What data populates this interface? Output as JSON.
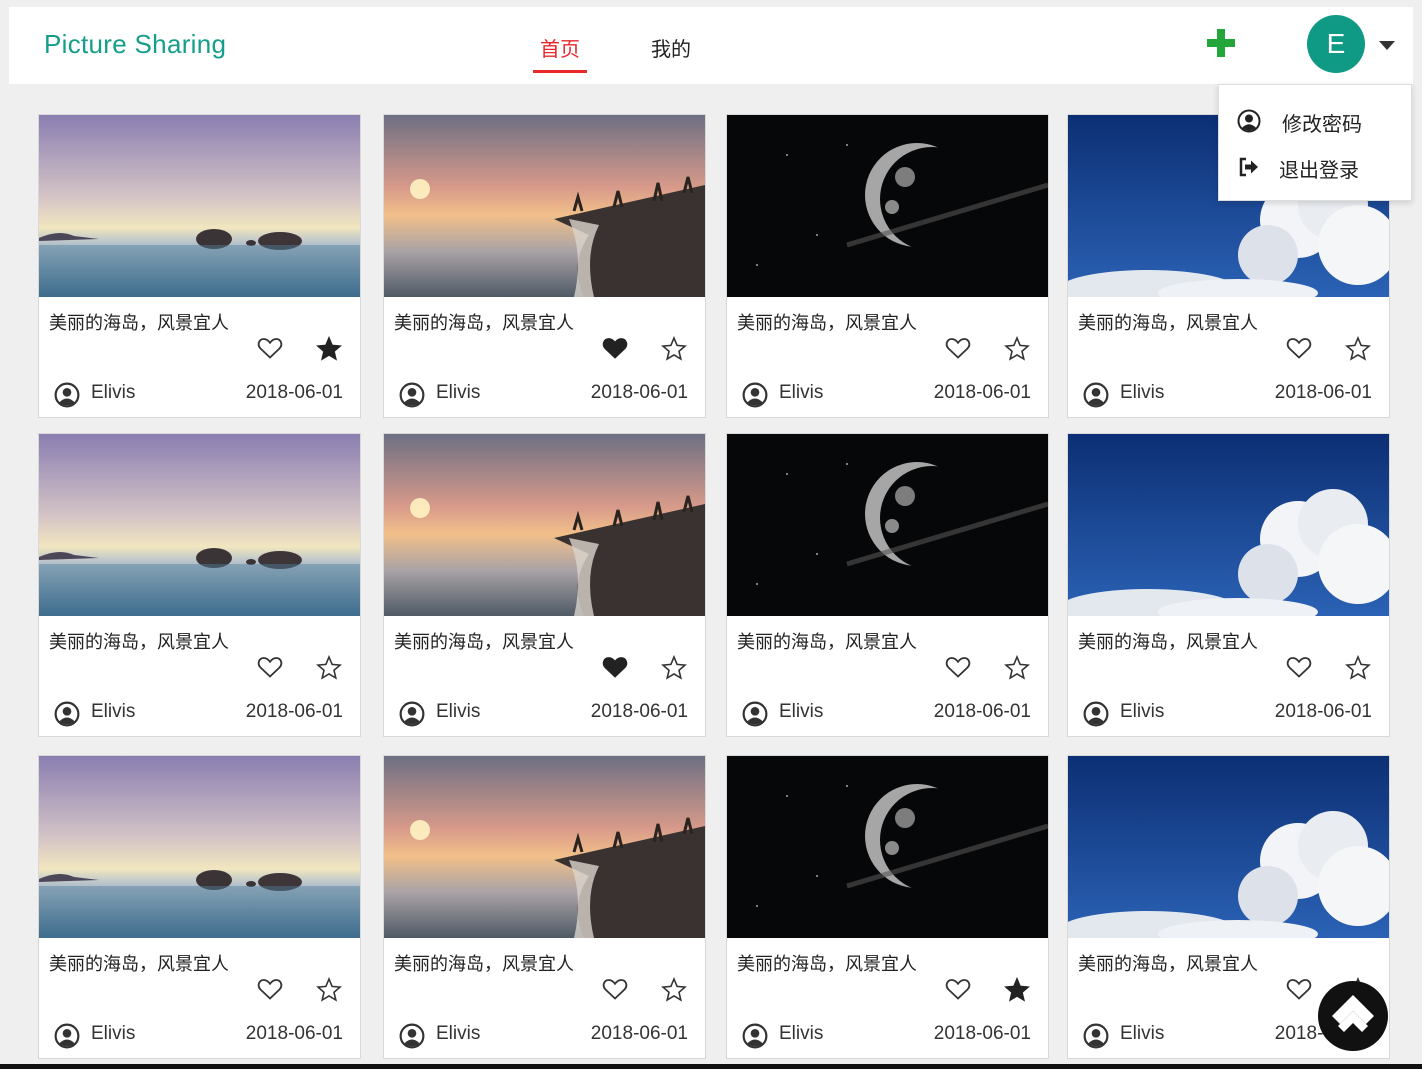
{
  "header": {
    "brand": "Picture Sharing",
    "tabs": [
      {
        "label": "首页",
        "active": true
      },
      {
        "label": "我的",
        "active": false
      }
    ],
    "add_icon": "plus-icon",
    "avatar_letter": "E",
    "caret_icon": "caret-down-icon"
  },
  "dropdown": {
    "items": [
      {
        "label": "修改密码",
        "icon": "user-circle-icon"
      },
      {
        "label": "退出登录",
        "icon": "sign-out-icon"
      }
    ]
  },
  "colors": {
    "brand": "#159f8a",
    "active_tab": "#e8282b",
    "avatar": "#0f9a86",
    "add_icon": "#22a63a"
  },
  "cards": [
    {
      "image": "sea-rocks",
      "title": "美丽的海岛，风景宜人",
      "liked": false,
      "favorited": true,
      "author": "Elivis",
      "date": "2018-06-01"
    },
    {
      "image": "sunset-beach",
      "title": "美丽的海岛，风景宜人",
      "liked": true,
      "favorited": false,
      "author": "Elivis",
      "date": "2018-06-01"
    },
    {
      "image": "moon",
      "title": "美丽的海岛，风景宜人",
      "liked": false,
      "favorited": false,
      "author": "Elivis",
      "date": "2018-06-01"
    },
    {
      "image": "clouds",
      "title": "美丽的海岛，风景宜人",
      "liked": false,
      "favorited": false,
      "author": "Elivis",
      "date": "2018-06-01"
    },
    {
      "image": "sea-rocks",
      "title": "美丽的海岛，风景宜人",
      "liked": false,
      "favorited": false,
      "author": "Elivis",
      "date": "2018-06-01"
    },
    {
      "image": "sunset-beach",
      "title": "美丽的海岛，风景宜人",
      "liked": true,
      "favorited": false,
      "author": "Elivis",
      "date": "2018-06-01"
    },
    {
      "image": "moon",
      "title": "美丽的海岛，风景宜人",
      "liked": false,
      "favorited": false,
      "author": "Elivis",
      "date": "2018-06-01"
    },
    {
      "image": "clouds",
      "title": "美丽的海岛，风景宜人",
      "liked": false,
      "favorited": false,
      "author": "Elivis",
      "date": "2018-06-01"
    },
    {
      "image": "sea-rocks",
      "title": "美丽的海岛，风景宜人",
      "liked": false,
      "favorited": false,
      "author": "Elivis",
      "date": "2018-06-01"
    },
    {
      "image": "sunset-beach",
      "title": "美丽的海岛，风景宜人",
      "liked": false,
      "favorited": false,
      "author": "Elivis",
      "date": "2018-06-01"
    },
    {
      "image": "moon",
      "title": "美丽的海岛，风景宜人",
      "liked": false,
      "favorited": true,
      "author": "Elivis",
      "date": "2018-06-01"
    },
    {
      "image": "clouds",
      "title": "美丽的海岛，风景宜人",
      "liked": false,
      "favorited": false,
      "author": "Elivis",
      "date": "2018-06-01"
    }
  ],
  "back_to_top_icon": "chevron-up-icon"
}
